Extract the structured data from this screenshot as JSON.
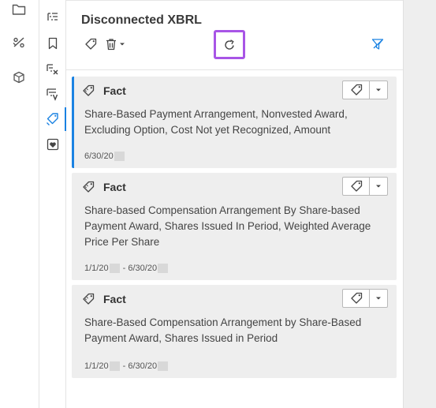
{
  "panel": {
    "title": "Disconnected XBRL"
  },
  "left_rail": {
    "icons": [
      "folder-icon",
      "percent-icon",
      "cube-icon"
    ]
  },
  "tool_rail": {
    "icons": [
      "outline-icon",
      "bookmark-icon",
      "filter-x-icon",
      "filter-v-icon",
      "tag-link-icon",
      "heart-box-icon"
    ],
    "active": "tag-link-icon"
  },
  "cards": [
    {
      "type": "Fact",
      "text": "Share-Based Payment Arrangement, Nonvested Award, Excluding Option, Cost Not yet Recognized, Amount",
      "period_start": "6/30/20",
      "period_end": "",
      "selected": true
    },
    {
      "type": "Fact",
      "text": "Share-based Compensation Arrangement By Share-based Payment Award, Shares Issued In Period, Weighted Average Price Per Share",
      "period_start": "1/1/20",
      "period_sep": " - ",
      "period_end": "6/30/20",
      "selected": false
    },
    {
      "type": "Fact",
      "text": "Share-Based Compensation Arrangement by Share-Based Payment Award, Shares Issued in Period",
      "period_start": "1/1/20",
      "period_sep": " - ",
      "period_end": "6/30/20",
      "selected": false
    }
  ],
  "colors": {
    "accent": "#1a82e2",
    "highlight": "#a855e6",
    "card_bg": "#eeeeee"
  }
}
